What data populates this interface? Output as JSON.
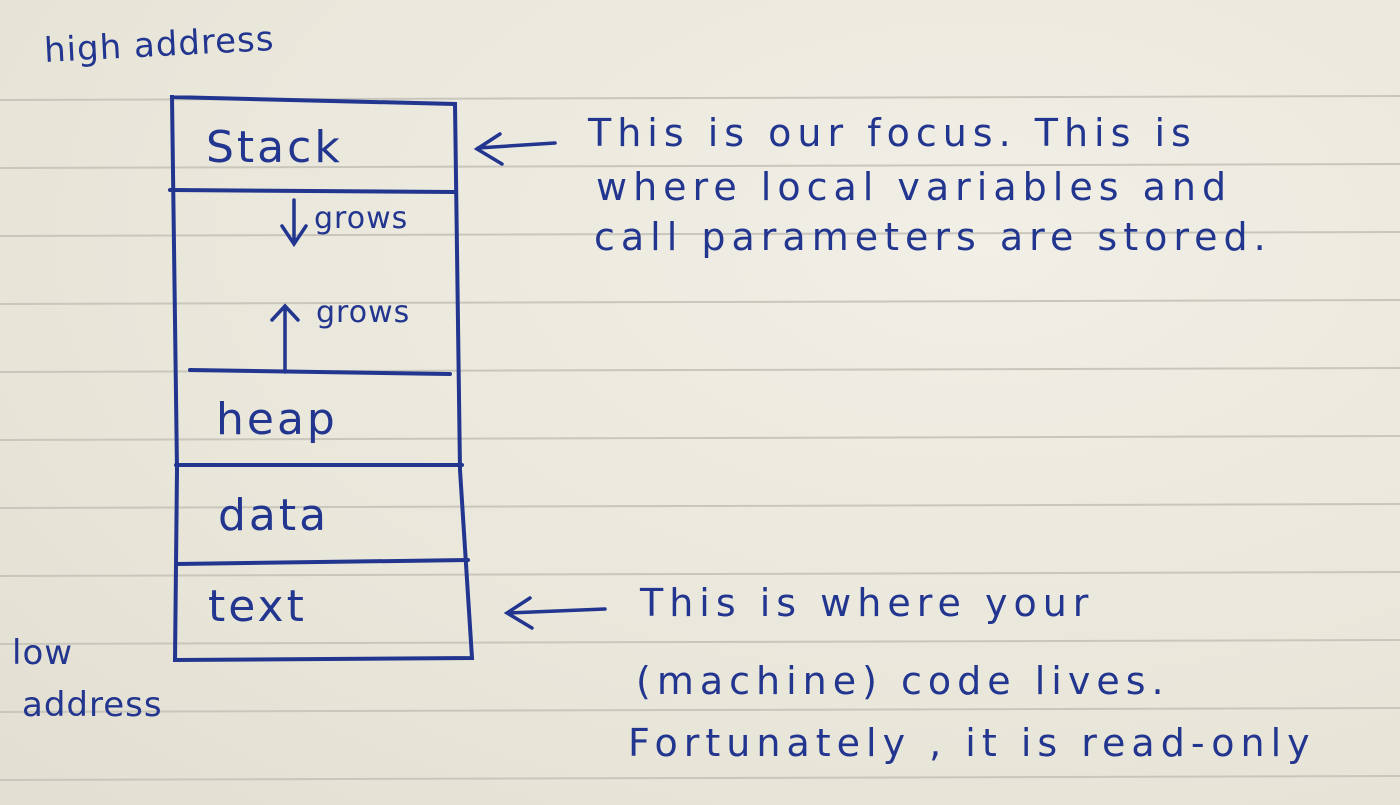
{
  "labels": {
    "high_address": "high address",
    "low_address_line1": "low",
    "low_address_line2": "address"
  },
  "memory_layout": {
    "segments": [
      "Stack",
      "heap",
      "data",
      "text"
    ],
    "stack_growth": "grows",
    "heap_growth": "grows"
  },
  "annotations": {
    "stack_note": [
      "This   is  our  focus. This   is",
      "where  local  variables  and",
      "call  parameters  are  stored."
    ],
    "text_note": [
      "This  is    where   your",
      "(machine)  code  lives.",
      "Fortunately , it  is  read-only"
    ]
  },
  "colors": {
    "ink": "#22358f",
    "paper": "#ebe8dc",
    "ruled_line": "#c9c6bb"
  }
}
